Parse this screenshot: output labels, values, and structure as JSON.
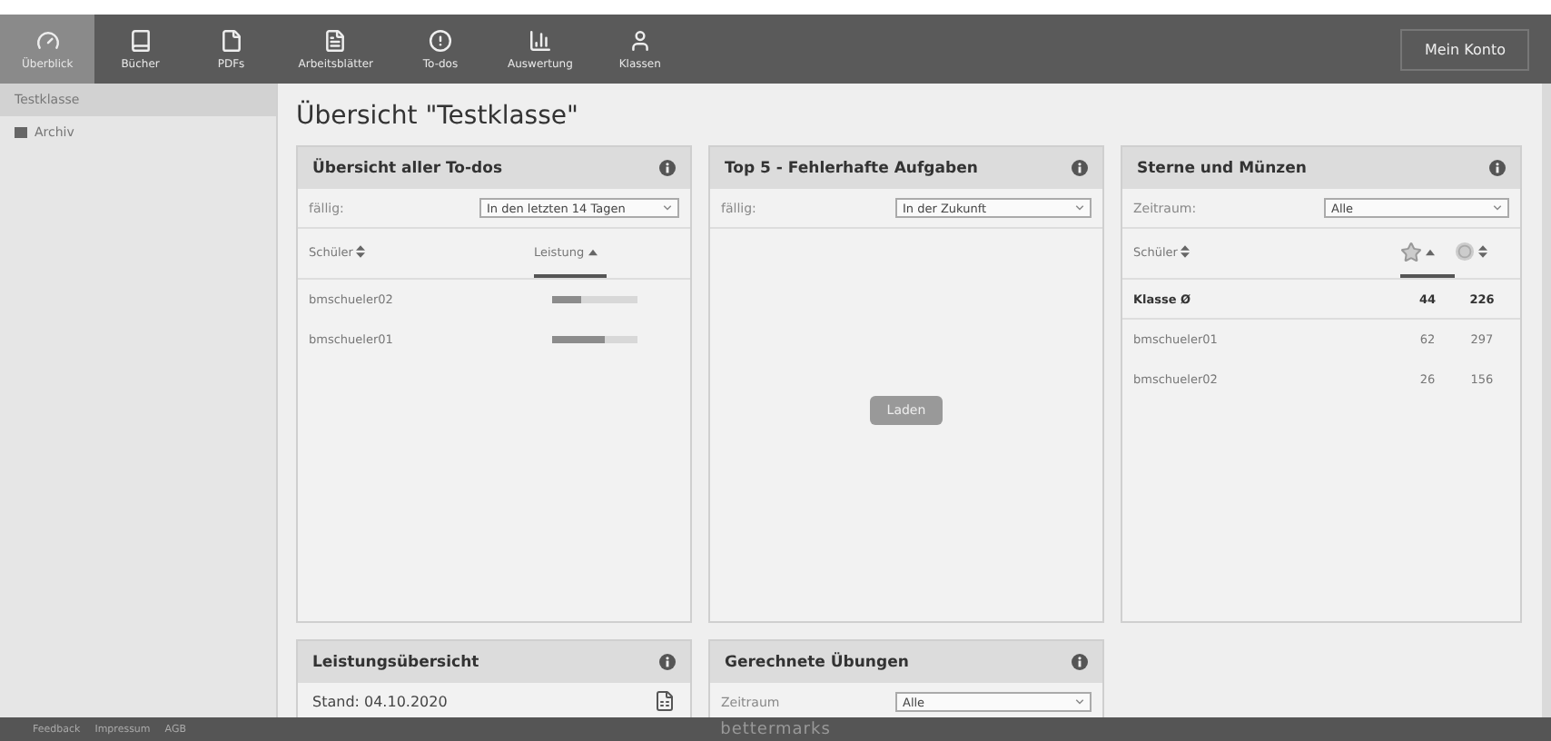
{
  "nav": {
    "items": [
      {
        "label": "Überblick",
        "kind": "gauge",
        "selected": true
      },
      {
        "label": "Bücher",
        "kind": "book",
        "selected": false
      },
      {
        "label": "PDFs",
        "kind": "pdf",
        "selected": false
      },
      {
        "label": "Arbeitsblätter",
        "kind": "sheet",
        "selected": false
      },
      {
        "label": "To-dos",
        "kind": "alert",
        "selected": false
      },
      {
        "label": "Auswertung",
        "kind": "chart",
        "selected": false
      },
      {
        "label": "Klassen",
        "kind": "user",
        "selected": false
      }
    ],
    "account_button": "Mein Konto"
  },
  "sidebar": {
    "items": [
      {
        "label": "Testklasse",
        "selected": true
      },
      {
        "label": "Archiv",
        "selected": false
      }
    ]
  },
  "page_title": "Übersicht \"Testklasse\"",
  "panels": [
    {
      "kind": "todos",
      "title": "Übersicht aller To-dos",
      "filter": {
        "label": "fällig:",
        "value": "In den letzten 14 Tagen"
      },
      "columns": [
        {
          "label": "Schüler",
          "sorted": false
        },
        {
          "label": "Leistung",
          "sorted": true
        }
      ],
      "rows": [
        {
          "student": "bmschueler02",
          "level": 0.33
        },
        {
          "student": "bmschueler01",
          "level": 0.62
        }
      ]
    },
    {
      "kind": "top5",
      "title": "Top 5 - Fehlerhafte Aufgaben",
      "filter": {
        "label": "fällig:",
        "value": "In der Zukunft"
      },
      "button": "Laden"
    },
    {
      "kind": "stars",
      "title": "Sterne und Münzen",
      "filter": {
        "label": "Zeitraum:",
        "value": "Alle"
      },
      "columns": [
        {
          "kind": "text",
          "label": "Schüler",
          "sorted": false
        },
        {
          "kind": "star",
          "sorted": true
        },
        {
          "kind": "coin",
          "sorted": false
        }
      ],
      "rows": [
        {
          "student": "Klasse Ø",
          "stars": "44",
          "coins": "226",
          "summary": true
        },
        {
          "student": "bmschueler01",
          "stars": "62",
          "coins": "297",
          "summary": false
        },
        {
          "student": "bmschueler02",
          "stars": "26",
          "coins": "156",
          "summary": false
        }
      ]
    },
    {
      "kind": "report",
      "title": "Leistungsübersicht",
      "stand": "Stand: 04.10.2020"
    },
    {
      "kind": "exercises",
      "title": "Gerechnete Übungen",
      "filter": {
        "label": "Zeitraum",
        "value": "Alle"
      }
    }
  ],
  "footer": {
    "links": [
      "Feedback",
      "Impressum",
      "AGB"
    ],
    "logo": "bettermarks"
  }
}
